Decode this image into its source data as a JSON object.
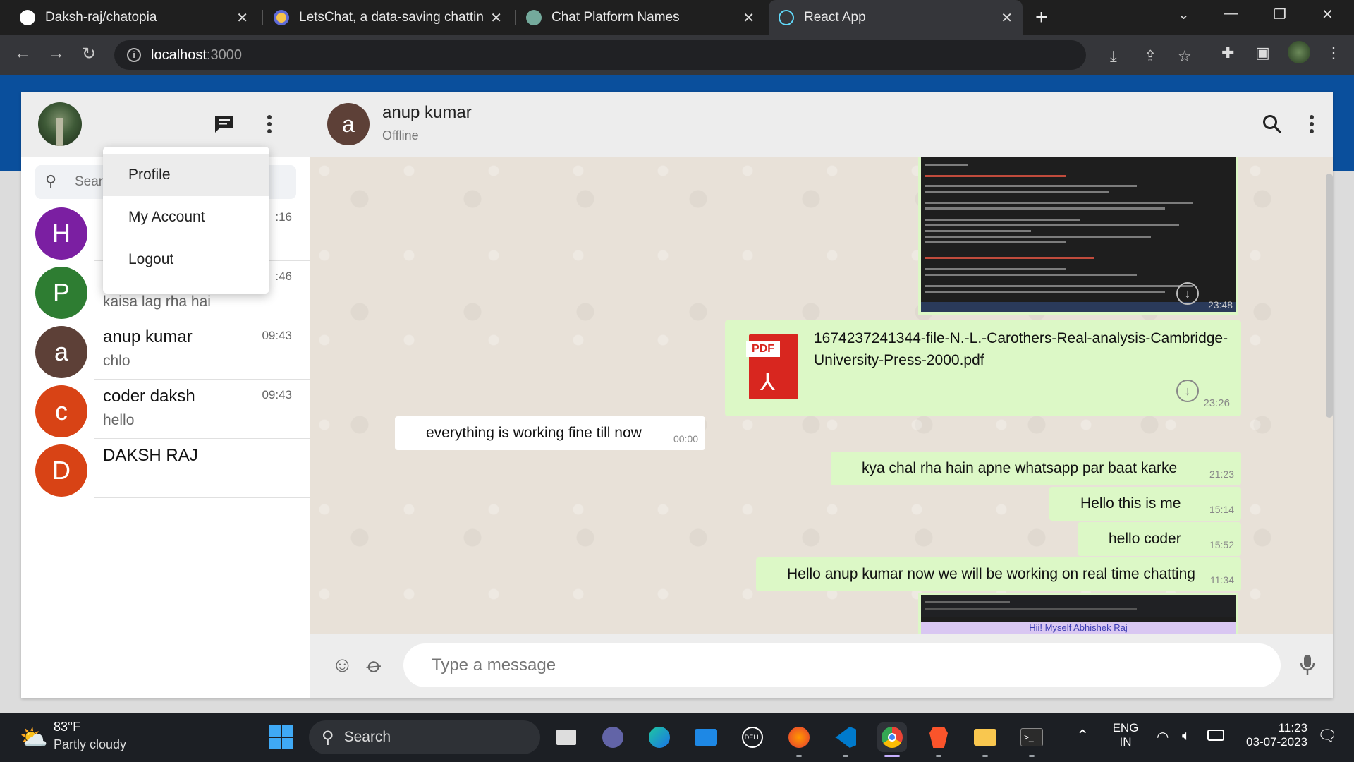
{
  "browser": {
    "tabs": [
      {
        "title": "Daksh-raj/chatopia",
        "icon": "github-icon"
      },
      {
        "title": "LetsChat, a data-saving chatting",
        "icon": "app-icon"
      },
      {
        "title": "Chat Platform Names",
        "icon": "chatgpt-icon"
      },
      {
        "title": "React App",
        "icon": "react-icon"
      }
    ],
    "url_host": "localhost",
    "url_port": ":3000"
  },
  "sidebar": {
    "menu": [
      "Profile",
      "My Account",
      "Logout"
    ],
    "search_placeholder": "Search or start new chat",
    "conversations": [
      {
        "initial": "H",
        "name": "",
        "last": "",
        "time": ":16",
        "color": "#7b1fa2"
      },
      {
        "initial": "P",
        "name": "",
        "last": "kaisa lag rha hai",
        "time": ":46",
        "color": "#2e7d32"
      },
      {
        "initial": "a",
        "name": "anup kumar",
        "last": "chlo",
        "time": "09:43",
        "color": "#5d4037"
      },
      {
        "initial": "c",
        "name": "coder daksh",
        "last": "hello",
        "time": "09:43",
        "color": "#d84315"
      },
      {
        "initial": "D",
        "name": "DAKSH RAJ",
        "last": "",
        "time": "",
        "color": "#d84315"
      }
    ]
  },
  "chat": {
    "contact_initial": "a",
    "contact_name": "anup kumar",
    "contact_status": "Offline",
    "messages": {
      "img1_time": "23:48",
      "pdf_name": "1674237241344-file-N.-L.-Carothers-Real-analysis-Cambridge-University-Press-2000.pdf",
      "pdf_label": "PDF",
      "pdf_time": "23:26",
      "m1": {
        "text": "everything is working fine till now",
        "time": "00:00"
      },
      "m2": {
        "text": "kya chal rha hain apne whatsapp par baat karke",
        "time": "21:23"
      },
      "m3": {
        "text": "Hello this is me",
        "time": "15:14"
      },
      "m4": {
        "text": "hello coder",
        "time": "15:52"
      },
      "m5": {
        "text": "Hello anup kumar now we will be working on real time chatting",
        "time": "11:34"
      },
      "img2_caption": "Hii! Myself Abhishek Raj"
    },
    "composer_placeholder": "Type a message"
  },
  "taskbar": {
    "temp": "83°F",
    "weather": "Partly cloudy",
    "search_label": "Search",
    "lang1": "ENG",
    "lang2": "IN",
    "time": "11:23",
    "date": "03-07-2023"
  }
}
